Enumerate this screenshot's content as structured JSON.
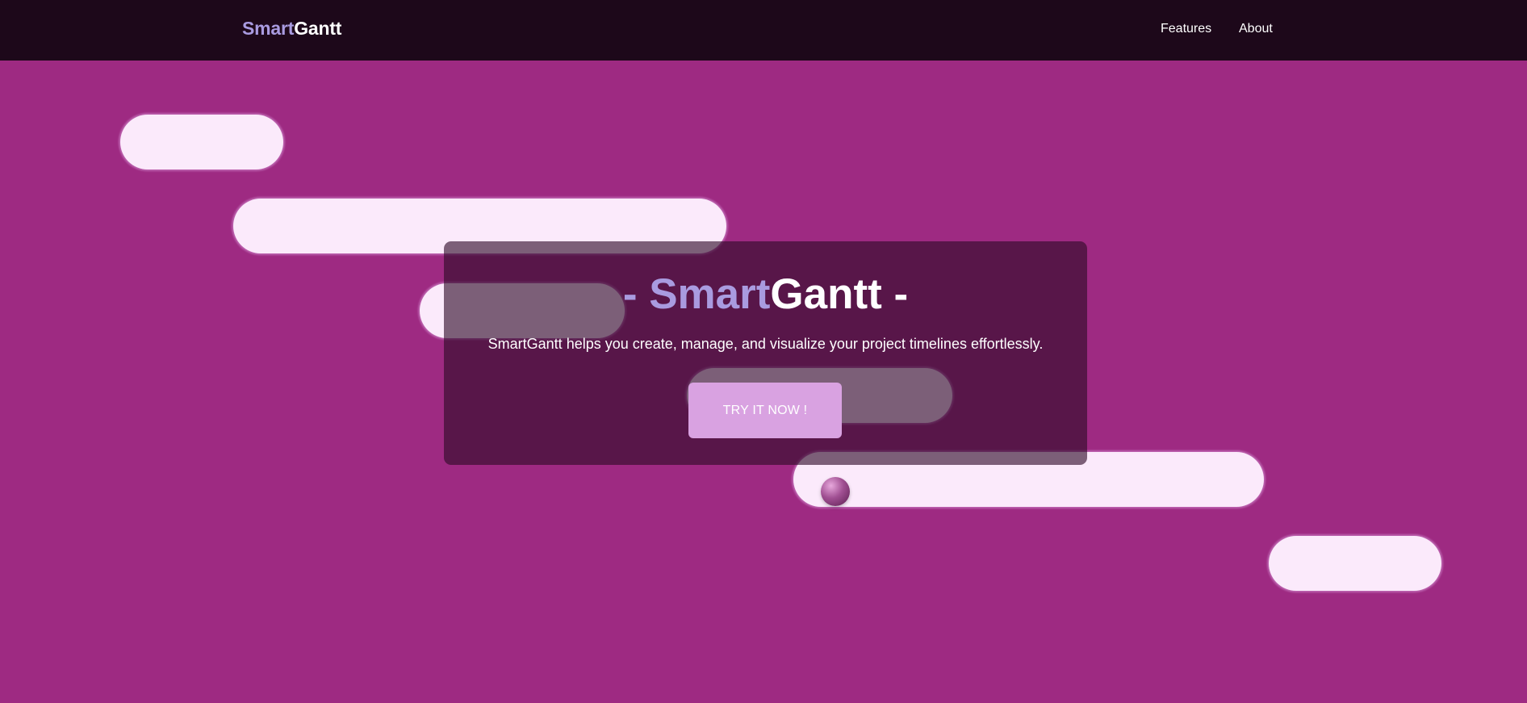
{
  "brand": {
    "smart": "Smart",
    "gantt": "Gantt"
  },
  "nav": {
    "features": "Features",
    "about": "About"
  },
  "hero": {
    "title_dash_left": "- ",
    "title_smart": "Smart",
    "title_gantt": "Gantt",
    "title_dash_right": " -",
    "subtitle": "SmartGantt helps you create, manage, and visualize your project timelines effortlessly.",
    "cta_label": "TRY IT NOW !"
  },
  "colors": {
    "navbar_bg": "#1d081a",
    "page_bg": "#9e2a82",
    "accent": "#a99be0",
    "bar_fill": "#fbeafb",
    "cta_bg": "#d9a2e1",
    "card_overlay": "#2d0a26"
  }
}
